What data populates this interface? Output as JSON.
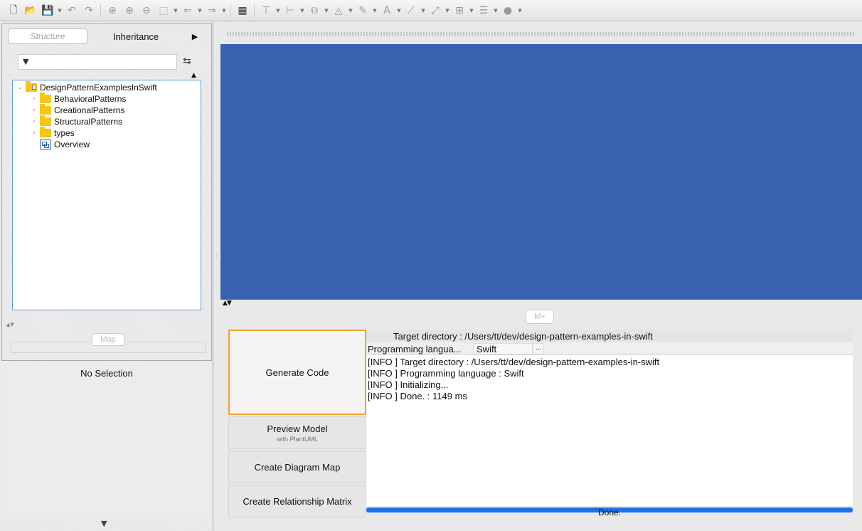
{
  "toolbar": {
    "icons": [
      "new-file-icon",
      "open-icon",
      "save-icon",
      "undo-icon",
      "redo-icon",
      "zoom-fit-icon",
      "zoom-in-icon",
      "zoom-out-icon",
      "zoom-select-icon",
      "back-icon",
      "forward-icon",
      "grid-icon",
      "align-top-icon",
      "align-left-icon",
      "layer-icon",
      "fill-icon",
      "line-color-icon",
      "font-color-icon",
      "line-style-icon",
      "connector-icon",
      "arrange-icon",
      "distribute-icon",
      "circle-icon"
    ]
  },
  "structure": {
    "tabs": {
      "structure": "Structure",
      "inheritance": "Inheritance",
      "more": "▶"
    },
    "filter": {
      "placeholder": "",
      "value": ""
    },
    "tree": {
      "root": "DesignPatternExamplesInSwift",
      "items": [
        "BehavioralPatterns",
        "CreationalPatterns",
        "StructuralPatterns",
        "types",
        "Overview"
      ]
    },
    "map_button": "Map"
  },
  "properties": {
    "no_selection": "No Selection"
  },
  "editor": {
    "m_plus_button": "M+",
    "colors": {
      "canvas": "#3861b0",
      "highlight": "#f0a030",
      "progress": "#1a73e8"
    }
  },
  "codegen": {
    "buttons": {
      "generate": "Generate Code",
      "preview": "Preview Model",
      "preview_sub": "with PlantUML",
      "diagram_map": "Create Diagram Map",
      "relationship_matrix": "Create Relationship Matrix"
    },
    "target_directory": "Target directory : /Users/tt/dev/design-pattern-examples-in-swift",
    "language_label": "Programming langua...",
    "language_value": "Swift",
    "language_more": "...",
    "log": [
      "[INFO ] Target directory : /Users/tt/dev/design-pattern-examples-in-swift",
      "[INFO ] Programming language : Swift",
      "[INFO ] Initializing...",
      "[INFO ] Done. : 1149 ms"
    ],
    "progress_text": "Done.",
    "progress_percent": 100
  }
}
